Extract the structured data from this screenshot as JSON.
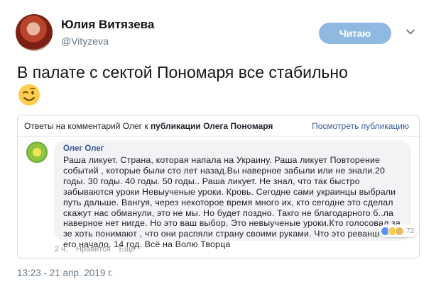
{
  "author": {
    "name": "Юлия Витязева",
    "handle": "@Vityzeva",
    "follow_label": "Читаю"
  },
  "tweet": {
    "text": "В палате с сектой Пономаря все стабильно",
    "emoji": "winking-face"
  },
  "embedded_card": {
    "header_prefix": "Ответы на комментарий Олег к",
    "header_bold": "публикации Олега Пономаря",
    "header_link": "Посмотреть публикацию",
    "comment": {
      "author": "Олег Олег",
      "text": "Раша ликует. Страна, которая напала на Украину. Раша ликует Повторение событий , которые были сто лет назад.Вы наверное забыли или не знали.20 годы. 30 годы. 40 годы. 50 годы.. Раша ликует. Не знал, что так быстро забываются уроки Невыученые уроки. Кровь. Сегодне сами украинцы выбрали путь дальше. Вангуя, через некоторое время много их, кто сегодне это сделал скажут нас обманули, это не мы. Но будет поздно. Такго не благодарного б..ла наверное нет нигде. Но это ваш выбор. Это невыученые уроки.Кто голосовал за зе хоть понимают , что они распяли страну своими руками. Что это реванш или его начало. 14 год. Всё на Волю Творца",
      "reaction_count": "72",
      "time": "2 ч.",
      "like_label": "Нравится",
      "more_label": "Ещё"
    }
  },
  "timestamp": "13:23 - 21 апр. 2019 г.",
  "colors": {
    "follow_button": "#8fb9e0",
    "link_blue": "#365899",
    "bubble_bg": "#f2f3f5"
  }
}
